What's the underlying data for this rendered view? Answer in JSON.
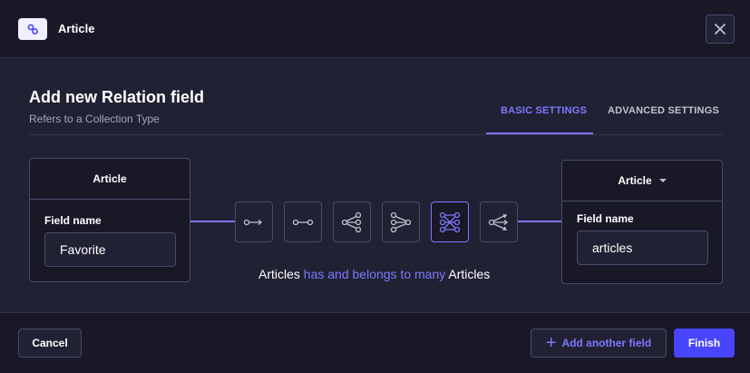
{
  "header": {
    "title": "Article",
    "icon": "relation-link-icon"
  },
  "title": "Add new Relation field",
  "subtitle": "Refers to a Collection Type",
  "tabs": [
    {
      "label": "BASIC SETTINGS",
      "active": true
    },
    {
      "label": "ADVANCED SETTINGS",
      "active": false
    }
  ],
  "left_card": {
    "title": "Article",
    "field_label": "Field name",
    "field_value": "Favorite"
  },
  "right_card": {
    "title": "Article",
    "field_label": "Field name",
    "field_value": "articles"
  },
  "relation_types": [
    {
      "icon": "one-way-icon",
      "active": false
    },
    {
      "icon": "one-to-one-icon",
      "active": false
    },
    {
      "icon": "one-to-many-icon",
      "active": false
    },
    {
      "icon": "many-to-one-icon",
      "active": false
    },
    {
      "icon": "many-to-many-icon",
      "active": true
    },
    {
      "icon": "many-way-icon",
      "active": false
    }
  ],
  "relation_text": {
    "left": "Articles",
    "middle": "has and belongs to many",
    "right": "Articles"
  },
  "footer": {
    "cancel": "Cancel",
    "add_another": "Add another field",
    "finish": "Finish"
  },
  "colors": {
    "accent": "#7b79ff",
    "primary": "#4945ff",
    "background": "#212134",
    "dark": "#181826",
    "border": "#4a4a6a"
  }
}
